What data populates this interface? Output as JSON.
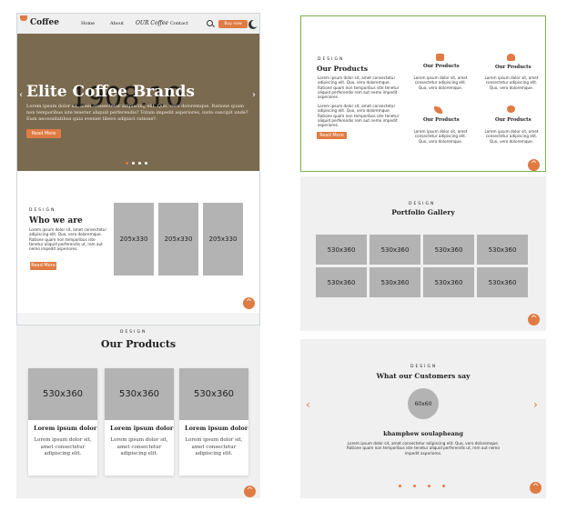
{
  "colors": {
    "accent": "#e07b43",
    "hero_bg": "#7a6a4f",
    "placeholder": "#b3b3b3"
  },
  "header": {
    "logo": "Coffee",
    "nav": [
      "Home",
      "About",
      "OUR Coffee",
      "Contact"
    ],
    "buy_now": "Buy now",
    "icons": [
      "search-icon",
      "moon-icon"
    ]
  },
  "hero": {
    "bg_number": "1908.10",
    "title": "Elite Coffee Brands",
    "text": "Lorem ipsum dolor sit, amet consectetur adipiscing elit. Quo, vero doloremque. Ratione quam non temporibus iste tenetur aliquid perferendis? Totam impedit asperiores, iusto suscipit unde? Eum necessitatibus quia eveniet libero adipisci ratione?.",
    "read_more": "Read More",
    "prev": "‹",
    "next": "›"
  },
  "who": {
    "design": "DESIGN",
    "title": "Who we are",
    "text": "Lorem ipsum dolor sit, amet consectetur adipiscing elit. Quo, vero doloremque. Ratione quam non temporibus iste tenetur aliquid perferendis ut, rem aut nemo impedit asperiores.",
    "read_more": "Read More",
    "images": [
      "205x330",
      "205x330",
      "205x330"
    ]
  },
  "products_cards": {
    "design": "DESIGN",
    "title": "Our Products",
    "cards": [
      {
        "image": "530x360",
        "title": "Lorem ipsum dolor",
        "text": "Lorem ipsum dolor sit, amet consectetur adipiscing elit."
      },
      {
        "image": "530x360",
        "title": "Lorem ipsum dolor",
        "text": "Lorem ipsum dolor sit, amet consectetur adipiscing elit."
      },
      {
        "image": "530x360",
        "title": "Lorem ipsum dolor",
        "text": "Lorem ipsum dolor sit, amet consectetur adipiscing elit."
      }
    ]
  },
  "products_icons": {
    "design": "DESIGN",
    "title": "Our Products",
    "text1": "Lorem ipsum dolor sit, amet consectetur adipiscing elit. Quo, vero doloremque. Ratione quam non temporibus iste tenetur aliquid perferendis rem aut nemo impedit asperiores.",
    "text2": "Lorem ipsum dolor sit, amet consectetur adipiscing elit. Quo, vero doloremque. Ratione quam non temporibus iste tenetur aliquid perferendis rem aut nemo impedit asperiores.",
    "read_more": "Read More",
    "items": [
      {
        "icon": "coffee-cup-icon",
        "name": "Our Products",
        "text": "Lorem ipsum dolor sit, amet consectetur adipiscing elit. Quo, vero doloremque."
      },
      {
        "icon": "wine-glass-icon",
        "name": "Our Products",
        "text": "Lorem ipsum dolor sit, amet consectetur adipiscing elit. Quo, vero doloremque."
      },
      {
        "icon": "leaf-icon",
        "name": "Our Products",
        "text": "Lorem ipsum dolor sit, amet consectetur adipiscing elit. Quo, vero doloremque."
      },
      {
        "icon": "clover-icon",
        "name": "Our Products",
        "text": "Lorem ipsum dolor sit, amet consectetur adipiscing elit. Quo, vero doloremque."
      }
    ]
  },
  "portfolio": {
    "design": "DESIGN",
    "title": "Portfolio Gallery",
    "images": [
      "530x360",
      "530x360",
      "530x360",
      "530x360",
      "530x360",
      "530x360",
      "530x360",
      "530x360"
    ]
  },
  "testimonials": {
    "design": "DESIGN",
    "title": "What our Customers say",
    "avatar": "60x60",
    "name": "khamphew soulapheang",
    "text": "Lorem ipsum dolor sit, amet consectetur adipiscing elit. Quo, vero doloremque. Ratione quam non temporibus iste tenetur aliquid perferendis ut, rem aut nemo impedit asperiores.",
    "prev": "‹",
    "next": "›"
  },
  "scroll_up": "^"
}
